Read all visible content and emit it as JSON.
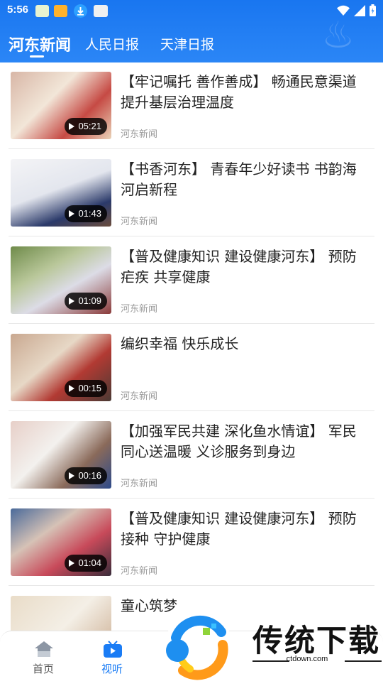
{
  "status_bar": {
    "time": "5:56"
  },
  "tabs": [
    {
      "label": "河东新闻",
      "active": true
    },
    {
      "label": "人民日报",
      "active": false
    },
    {
      "label": "天津日报",
      "active": false
    }
  ],
  "news": [
    {
      "title": "【牢记嘱托 善作善成】 畅通民意渠道 提升基层治理温度",
      "source": "河东新闻",
      "duration": "05:21"
    },
    {
      "title": "【书香河东】 青春年少好读书 书韵海河启新程",
      "source": "河东新闻",
      "duration": "01:43"
    },
    {
      "title": "【普及健康知识 建设健康河东】 预防疟疾 共享健康",
      "source": "河东新闻",
      "duration": "01:09"
    },
    {
      "title": "编织幸福 快乐成长",
      "source": "河东新闻",
      "duration": "00:15"
    },
    {
      "title": "【加强军民共建 深化鱼水情谊】 军民同心送温暖 义诊服务到身边",
      "source": "河东新闻",
      "duration": "00:16"
    },
    {
      "title": "【普及健康知识 建设健康河东】 预防接种 守护健康",
      "source": "河东新闻",
      "duration": "01:04"
    },
    {
      "title": "童心筑梦",
      "source": "",
      "duration": ""
    }
  ],
  "bottom_nav": [
    {
      "label": "首页",
      "icon": "home-icon",
      "active": false
    },
    {
      "label": "视听",
      "icon": "tv-icon",
      "active": true
    }
  ],
  "watermark": {
    "brand": "传统下载",
    "domain": "ctdown.com"
  },
  "colors": {
    "header": "#1976f0",
    "accent": "#1a7cf5"
  }
}
